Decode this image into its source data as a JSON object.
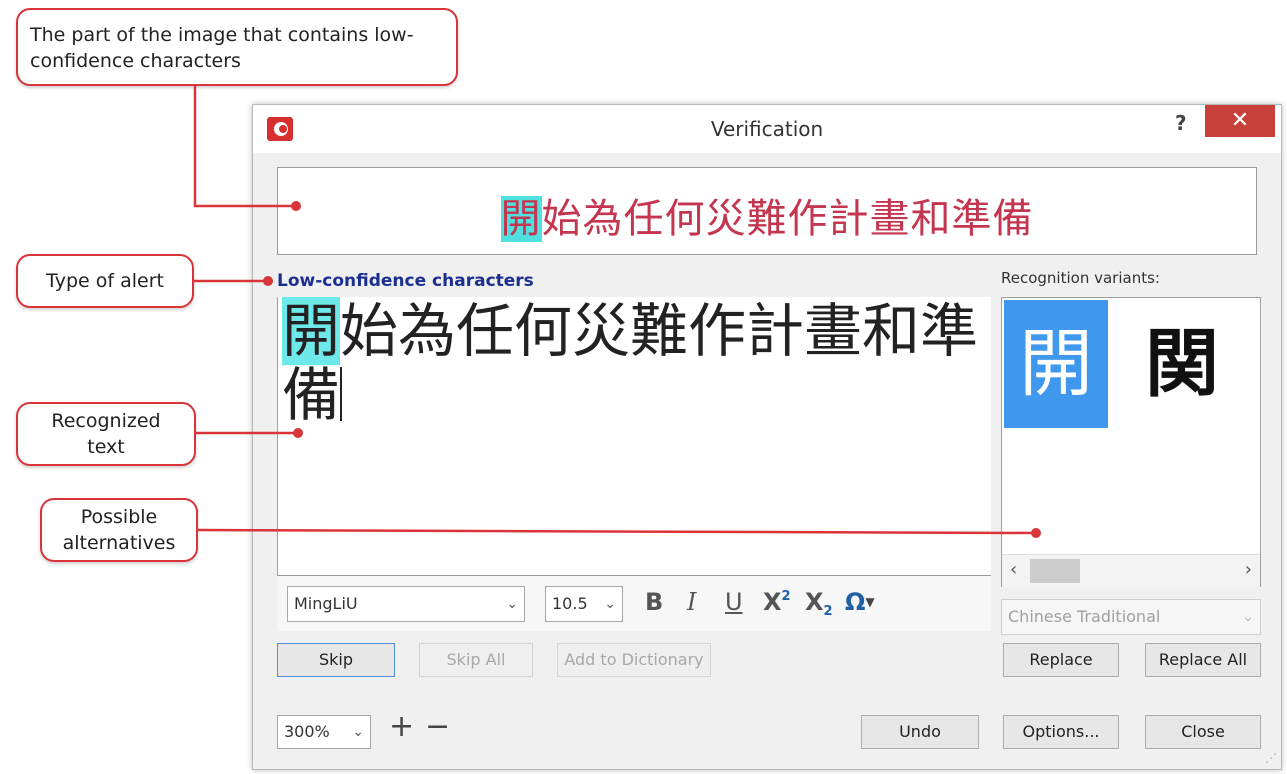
{
  "callouts": {
    "image_part": "The part of the image that contains low-confidence characters",
    "alert_type": "Type of alert",
    "recognized_text": "Recognized text",
    "alternatives": "Possible alternatives"
  },
  "dialog": {
    "title": "Verification",
    "help": "?",
    "close_glyph": "✕",
    "image_text_highlight": "開",
    "image_text_rest": "始為任何災難作計畫和準備",
    "alert_type": "Low-confidence characters",
    "recognized_text_highlight": "開",
    "recognized_text_rest": "始為任何災難作計畫和準備",
    "variants_label": "Recognition variants:",
    "variants": [
      "開",
      "関"
    ],
    "font": "MingLiU",
    "font_size": "10.5",
    "format_bold": "B",
    "format_italic": "I",
    "format_underline": "U",
    "format_superscript": "X",
    "format_subscript": "X",
    "format_superscript_mark": "2",
    "format_subscript_mark": "2",
    "format_omega": "Ω",
    "language": "Chinese Traditional",
    "buttons": {
      "skip": "Skip",
      "skip_all": "Skip All",
      "add_to_dictionary": "Add to Dictionary",
      "replace": "Replace",
      "replace_all": "Replace All",
      "undo": "Undo",
      "options": "Options...",
      "close": "Close"
    },
    "zoom": "300%",
    "zoom_in": "+",
    "zoom_out": "−"
  },
  "colors": {
    "callout_border": "#d9343a",
    "title_close": "#c7403a",
    "highlight": "#4fe0e0",
    "variant_selected": "#3f97ee",
    "alert_text": "#1a2f8f",
    "image_text": "#c4364f"
  }
}
